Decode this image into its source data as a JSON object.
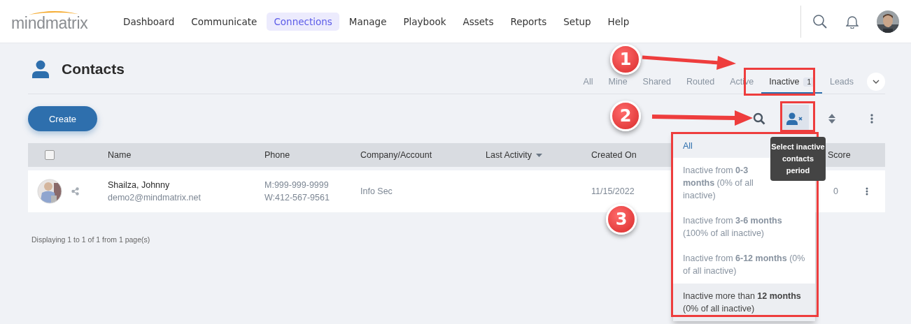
{
  "nav": {
    "logo": "mindmatrix",
    "items": [
      {
        "label": "Dashboard",
        "selected": false
      },
      {
        "label": "Communicate",
        "selected": false
      },
      {
        "label": "Connections",
        "selected": true
      },
      {
        "label": "Manage",
        "selected": false
      },
      {
        "label": "Playbook",
        "selected": false
      },
      {
        "label": "Assets",
        "selected": false
      },
      {
        "label": "Reports",
        "selected": false
      },
      {
        "label": "Setup",
        "selected": false
      },
      {
        "label": "Help",
        "selected": false
      }
    ]
  },
  "page": {
    "title": "Contacts"
  },
  "tabs": [
    {
      "label": "All",
      "selected": false
    },
    {
      "label": "Mine",
      "selected": false
    },
    {
      "label": "Shared",
      "selected": false
    },
    {
      "label": "Routed",
      "selected": false
    },
    {
      "label": "Active",
      "selected": false
    },
    {
      "label": "Inactive",
      "selected": true,
      "badge": "1"
    },
    {
      "label": "Leads",
      "selected": false
    }
  ],
  "toolbar": {
    "create": "Create"
  },
  "table": {
    "select_all": {
      "checked": false
    },
    "columns": [
      {
        "label": "Name",
        "sorted": false
      },
      {
        "label": "Phone",
        "sorted": false
      },
      {
        "label": "Company/Account",
        "sorted": false
      },
      {
        "label": "Last Activity",
        "sorted": true
      },
      {
        "label": "Created On",
        "sorted": false
      },
      {
        "label": "Score",
        "sorted": false
      }
    ],
    "rows": [
      {
        "name": "Shailza, Johnny",
        "email": "demo2@mindmatrix.net",
        "phones": [
          "M:999-999-9999",
          "W:412-567-9561"
        ],
        "company": "Info Sec",
        "created": "11/15/2022",
        "score": "0"
      }
    ],
    "footer": "Displaying 1 to 1 of 1 from 1 page(s)"
  },
  "inactive_menu": {
    "tooltip": "Select inactive contacts period",
    "items": [
      {
        "text": "All",
        "selected": true,
        "hovered": false
      },
      {
        "text": "Inactive from **0-3 months** (0% of all inactive)",
        "selected": false,
        "hovered": false
      },
      {
        "text": "Inactive from **3-6 months** (100% of all inactive)",
        "selected": false,
        "hovered": false
      },
      {
        "text": "Inactive from **6-12 months** (0% of all inactive)",
        "selected": false,
        "hovered": false
      },
      {
        "text": "Inactive more than **12 months** (0% of all inactive)",
        "selected": false,
        "hovered": true
      }
    ]
  },
  "callouts": [
    {
      "number": "1"
    },
    {
      "number": "2"
    },
    {
      "number": "3"
    }
  ]
}
